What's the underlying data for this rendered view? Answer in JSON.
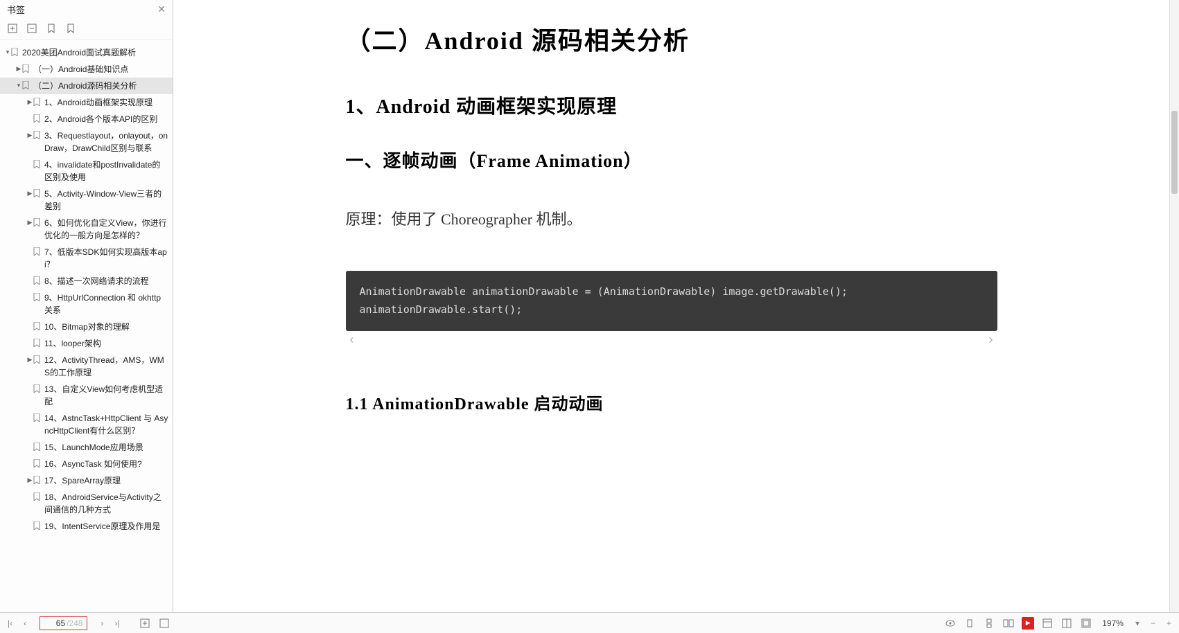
{
  "sidebar": {
    "title": "书签",
    "root": "2020美团Android面试真题解析",
    "items": [
      {
        "label": "（一）Android基础知识点",
        "depth": 1,
        "tw": "▶",
        "sel": false
      },
      {
        "label": "（二）Android源码相关分析",
        "depth": 1,
        "tw": "▾",
        "sel": true
      },
      {
        "label": "1、Android动画框架实现原理",
        "depth": 2,
        "tw": "▶",
        "sel": false
      },
      {
        "label": "2、Android各个版本API的区别",
        "depth": 2,
        "tw": "",
        "sel": false
      },
      {
        "label": "3、Requestlayout，onlayout，onDraw，DrawChild区别与联系",
        "depth": 2,
        "tw": "▶",
        "sel": false
      },
      {
        "label": "4、invalidate和postInvalidate的区别及使用",
        "depth": 2,
        "tw": "",
        "sel": false
      },
      {
        "label": "5、Activity-Window-View三者的差别",
        "depth": 2,
        "tw": "▶",
        "sel": false
      },
      {
        "label": "6、如何优化自定义View，你进行优化的一般方向是怎样的？",
        "depth": 2,
        "tw": "▶",
        "sel": false
      },
      {
        "label": "7、低版本SDK如何实现高版本api？",
        "depth": 2,
        "tw": "",
        "sel": false
      },
      {
        "label": "8、描述一次网络请求的流程",
        "depth": 2,
        "tw": "",
        "sel": false
      },
      {
        "label": "9、HttpUrlConnection 和 okhttp关系",
        "depth": 2,
        "tw": "",
        "sel": false
      },
      {
        "label": "10、Bitmap对象的理解",
        "depth": 2,
        "tw": "",
        "sel": false
      },
      {
        "label": "11、looper架构",
        "depth": 2,
        "tw": "",
        "sel": false
      },
      {
        "label": "12、ActivityThread，AMS，WMS的工作原理",
        "depth": 2,
        "tw": "▶",
        "sel": false
      },
      {
        "label": "13、自定义View如何考虑机型适配",
        "depth": 2,
        "tw": "",
        "sel": false
      },
      {
        "label": "14、AstncTask+HttpClient 与 AsyncHttpClient有什么区别？",
        "depth": 2,
        "tw": "",
        "sel": false
      },
      {
        "label": "15、LaunchMode应用场景",
        "depth": 2,
        "tw": "",
        "sel": false
      },
      {
        "label": "16、AsyncTask 如何使用?",
        "depth": 2,
        "tw": "",
        "sel": false
      },
      {
        "label": "17、SpareArray原理",
        "depth": 2,
        "tw": "▶",
        "sel": false
      },
      {
        "label": "18、AndroidService与Activity之间通信的几种方式",
        "depth": 2,
        "tw": "",
        "sel": false
      },
      {
        "label": "19、IntentService原理及作用是",
        "depth": 2,
        "tw": "",
        "sel": false
      }
    ]
  },
  "doc": {
    "title": "（二）Android 源码相关分析",
    "h1": "1、Android 动画框架实现原理",
    "h2": "一、逐帧动画（Frame Animation）",
    "para": "原理：使用了 Choreographer 机制。",
    "code": "AnimationDrawable animationDrawable = (AnimationDrawable) image.getDrawable();\nanimationDrawable.start();",
    "h3": "1.1 AnimationDrawable 启动动画"
  },
  "status": {
    "page_current": "65",
    "page_total": "/248",
    "zoom": "197%"
  }
}
